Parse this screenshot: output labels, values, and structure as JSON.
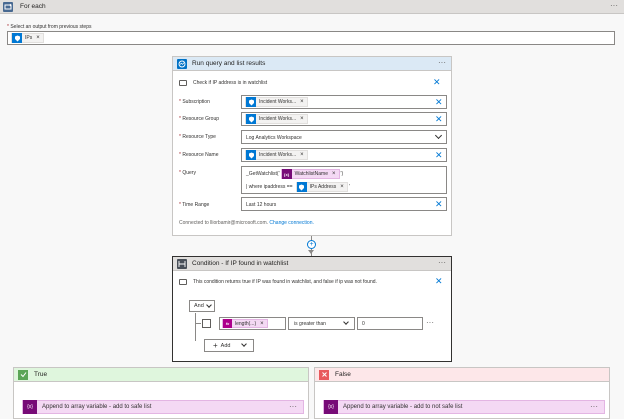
{
  "foreach": {
    "title": "For each",
    "more": "···"
  },
  "select_output": {
    "label": "Select an output from previous steps",
    "required_mark": "*",
    "token": "IPs"
  },
  "run_query": {
    "title": "Run query and list results",
    "more": "···",
    "description": "Check if IP address is in watchlist",
    "fields": {
      "subscription": {
        "label": "Subscription",
        "value": "Incident Works..."
      },
      "resource_group": {
        "label": "Resource Group",
        "value": "Incident Works..."
      },
      "resource_type": {
        "label": "Resource Type",
        "value": "Log Analytics Workspace"
      },
      "resource_name": {
        "label": "Resource Name",
        "value": "Incident Works..."
      },
      "query": {
        "label": "Query",
        "line1_prefix": "_GetWatchlist('",
        "line1_token": "WatchlistName",
        "line1_suffix": "')",
        "line2_prefix": "| where ipaddress ==",
        "line2_token": "IPs Address",
        "line2_suffix": "'"
      },
      "time_range": {
        "label": "Time Range",
        "value": "Last 12 hours"
      }
    },
    "connected_text": "Connected to lliorbamir@microsoft.com.",
    "change_connection": "Change connection."
  },
  "condition": {
    "title": "Condition - If IP found in watchlist",
    "more": "···",
    "description": "This condition returns true if IP was found in watchlist, and false if ip was not found.",
    "and_label": "And",
    "row": {
      "func_token": "length(...)",
      "operator": "is greater than",
      "value": "0",
      "more": "···"
    },
    "add_label": "Add"
  },
  "true_branch": {
    "label": "True",
    "action": "Append to array variable - add to safe list",
    "more": "···"
  },
  "false_branch": {
    "label": "False",
    "action": "Append to array variable - add to not safe list",
    "more": "···"
  },
  "colors": {
    "blue": "#0078d4",
    "purple": "#770b77",
    "true_green": "#dff6dd",
    "false_red": "#fde7e9"
  }
}
